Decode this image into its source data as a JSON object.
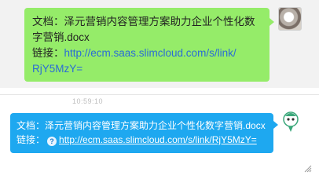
{
  "message_out": {
    "doc_label": "文档：",
    "doc_name_line1": "泽元营销内容管理方案助力企业个性化数",
    "doc_name_line2": "字营销.docx",
    "link_label": "链接：",
    "link_line1": "http://ecm.saas.slimcloud.com/s/link/",
    "link_line2": "RjY5MzY="
  },
  "timestamp": "10:59:10",
  "message_in": {
    "doc_label": "文档：",
    "doc_name": "泽元营销内容管理方案助力企业个性化数字营销.docx",
    "link_label": "链接：",
    "help_glyph": "?",
    "link": "http://ecm.saas.slimcloud.com/s/link/RjY5MzY="
  },
  "icons": {
    "user_avatar": "avatar-photo",
    "bot_avatar": "mascot-avatar",
    "help": "help-icon",
    "resize": "resize-icon"
  },
  "colors": {
    "green_bubble": "#95ec69",
    "blue_bubble": "#1ea8f0",
    "link": "#2a6cd6"
  }
}
